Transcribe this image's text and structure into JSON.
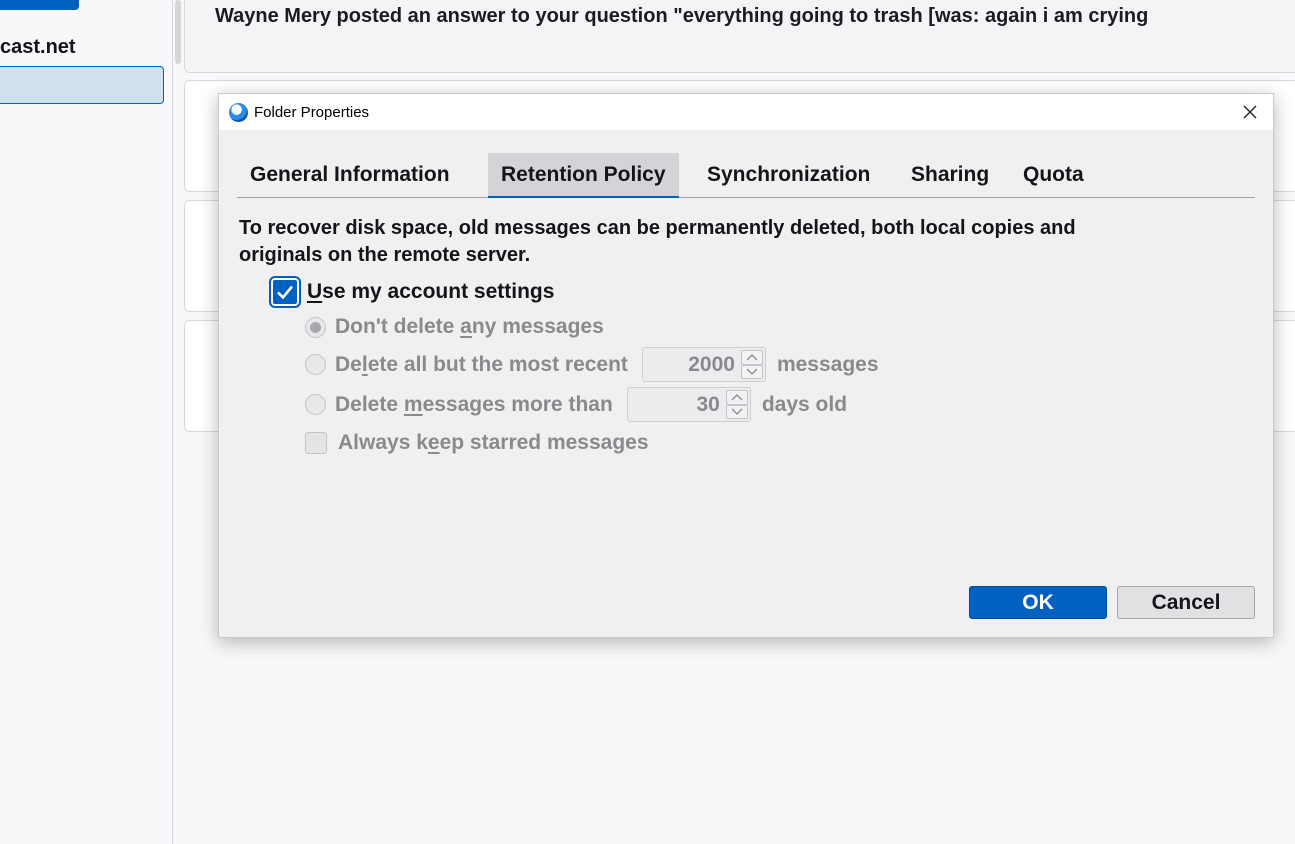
{
  "background": {
    "account_label": "cast.net",
    "notice_text": "Wayne Mery posted an answer to your question \"everything going to trash [was: again i am crying"
  },
  "dialog": {
    "title": "Folder Properties",
    "tabs": [
      {
        "label": "General Information",
        "active": false
      },
      {
        "label": "Retention Policy",
        "active": true
      },
      {
        "label": "Synchronization",
        "active": false
      },
      {
        "label": "Sharing",
        "active": false
      },
      {
        "label": "Quota",
        "active": false
      }
    ],
    "description": "To recover disk space, old messages can be permanently deleted, both local copies and originals on the remote server.",
    "use_account_settings": {
      "label": "Use my account settings",
      "checked": true
    },
    "options": {
      "dont_delete": {
        "label": "Don't delete any messages",
        "selected": true
      },
      "delete_recent": {
        "prefix": "Delete all but the most recent",
        "value": "2000",
        "suffix": "messages",
        "selected": false
      },
      "delete_older": {
        "prefix": "Delete messages more than",
        "value": "30",
        "suffix": "days old",
        "selected": false
      },
      "keep_starred": {
        "label": "Always keep starred messages",
        "checked": false
      }
    },
    "buttons": {
      "ok": "OK",
      "cancel": "Cancel"
    }
  },
  "colors": {
    "accent": "#0061c0",
    "disabled_text": "#8a8a8e",
    "dialog_bg": "#f0f0f0"
  }
}
